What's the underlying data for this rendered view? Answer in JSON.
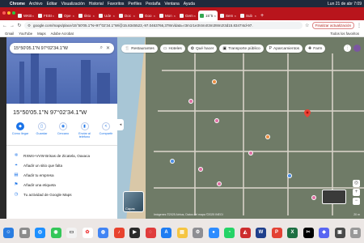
{
  "menubar": {
    "app": "Chrome",
    "items": [
      "Archivo",
      "Editar",
      "Visualización",
      "Historial",
      "Favoritos",
      "Perfiles",
      "Pestaña",
      "Ventana",
      "Ayuda"
    ],
    "clock": "Lun 21 de abr 7:09"
  },
  "tabs": [
    {
      "label": "WKB"
    },
    {
      "label": "FEBI"
    },
    {
      "label": "Ope"
    },
    {
      "label": "tikto"
    },
    {
      "label": "Ude"
    },
    {
      "label": "Doc"
    },
    {
      "label": "Goo"
    },
    {
      "label": "Mon"
    },
    {
      "label": "Gem"
    },
    {
      "label": "15°5",
      "active": true
    },
    {
      "label": "Sem"
    },
    {
      "label": "Sub"
    }
  ],
  "toolbar": {
    "url": "google.com/maps/place/15°50'05.1\"N+97°02'34.1\"W/@15.8345523,-97.0463766,378m/data=!3m1!1e3!4m4!3m3!8m2!3d15.8347!4d-97.",
    "update_label": "Finalizar actualización"
  },
  "bookmarks": {
    "items": [
      "Gmail",
      "YouTube",
      "Maps",
      "Adobe Acrobat"
    ],
    "all_label": "Todos los favoritos"
  },
  "search": {
    "value": "15°50'05.1\"N 97°02'34.1\"W"
  },
  "place": {
    "title": "15°50'05.1\"N 97°02'34.1\"W"
  },
  "actions": [
    {
      "label": "Cómo llegar",
      "icon": "directions-icon"
    },
    {
      "label": "Guardar",
      "icon": "bookmark-icon"
    },
    {
      "label": "Cercano",
      "icon": "nearby-icon"
    },
    {
      "label": "Enviar al teléfono",
      "icon": "phone-icon"
    },
    {
      "label": "Compartir",
      "icon": "share-icon"
    }
  ],
  "info_rows": [
    {
      "label": "RXM4+VVW Brisas de Zicatela, Oaxaca",
      "icon": "plus-code-icon"
    },
    {
      "label": "Añadir un sitio que falta",
      "icon": "add-place-icon"
    },
    {
      "label": "Añadir tu empresa",
      "icon": "business-icon"
    },
    {
      "label": "Añadir una etiqueta",
      "icon": "label-icon"
    },
    {
      "label": "Tu actividad de Google Maps",
      "icon": "history-icon"
    }
  ],
  "chips": [
    {
      "label": "Restaurantes",
      "icon": "restaurant-icon"
    },
    {
      "label": "Hoteles",
      "icon": "hotel-icon"
    },
    {
      "label": "Qué hacer",
      "icon": "activities-icon"
    },
    {
      "label": "Transporte público",
      "icon": "transit-icon"
    },
    {
      "label": "Aparcamientos",
      "icon": "parking-icon"
    },
    {
      "label": "Farm",
      "icon": "pharmacy-icon"
    }
  ],
  "map": {
    "layers_label": "Capas",
    "attribution": "Imágenes ©2025 Airbus, Datos del mapa ©2025 INEGI",
    "scale": "20 m"
  },
  "colors": {
    "tab_strip": "#b8151c",
    "maps_blue": "#1a73e8",
    "pin_red": "#ea4335"
  }
}
